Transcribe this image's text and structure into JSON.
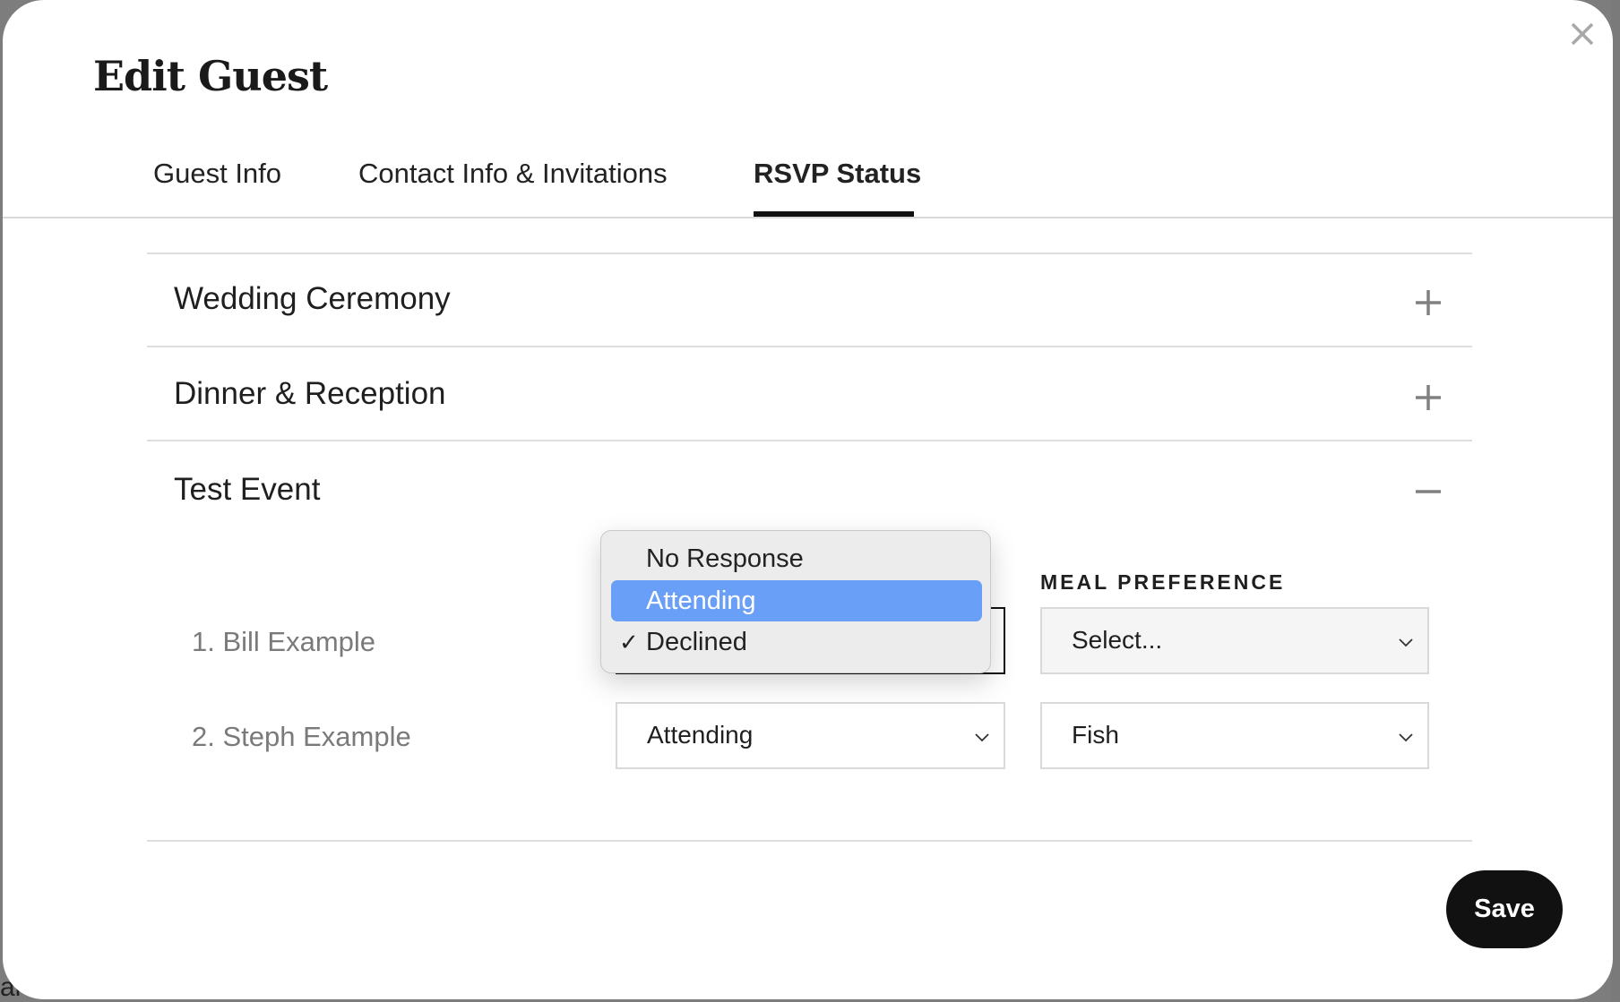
{
  "background": {
    "partial_text": "ar"
  },
  "modal": {
    "title": "Edit Guest",
    "close_icon": "close-icon"
  },
  "tabs": [
    {
      "label": "Guest Info",
      "active": false
    },
    {
      "label": "Contact Info & Invitations",
      "active": false
    },
    {
      "label": "RSVP Status",
      "active": true
    }
  ],
  "events": [
    {
      "name": "Wedding Ceremony",
      "expanded": false,
      "toggle_icon": "plus-icon"
    },
    {
      "name": "Dinner & Reception",
      "expanded": false,
      "toggle_icon": "plus-icon"
    },
    {
      "name": "Test Event",
      "expanded": true,
      "toggle_icon": "minus-icon"
    }
  ],
  "test_event": {
    "meal_preference_label": "MEAL PREFERENCE",
    "guests": [
      {
        "name": "1. Bill Example",
        "rsvp": "Declined",
        "meal": "Select..."
      },
      {
        "name": "2. Steph Example",
        "rsvp": "Attending",
        "meal": "Fish"
      }
    ]
  },
  "rsvp_dropdown": {
    "open_for": "1. Bill Example",
    "options": [
      {
        "label": "No Response",
        "checked": false,
        "highlighted": false
      },
      {
        "label": "Attending",
        "checked": false,
        "highlighted": true
      },
      {
        "label": "Declined",
        "checked": true,
        "highlighted": false
      }
    ],
    "check_glyph": "✓",
    "highlight_color": "#6a9ff8"
  },
  "footer": {
    "save_label": "Save"
  }
}
